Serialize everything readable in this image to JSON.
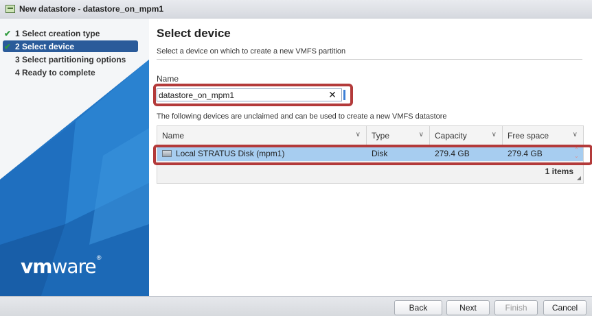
{
  "window": {
    "title": "New datastore - datastore_on_mpm1"
  },
  "wizard": {
    "steps": [
      {
        "label": "1 Select creation type",
        "checked": true
      },
      {
        "label": "2 Select device",
        "checked": true
      },
      {
        "label": "3 Select partitioning options",
        "checked": false
      },
      {
        "label": "4 Ready to complete",
        "checked": false
      }
    ],
    "active_step": 1,
    "logo": {
      "prefix": "vm",
      "suffix": "ware",
      "mark": "®"
    }
  },
  "page": {
    "heading": "Select device",
    "subtitle": "Select a device on which to create a new VMFS partition",
    "name_label": "Name",
    "name_value": "datastore_on_mpm1",
    "clear_glyph": "✕",
    "devices_description": "The following devices are unclaimed and can be used to create a new VMFS datastore"
  },
  "grid": {
    "columns": [
      "Name",
      "Type",
      "Capacity",
      "Free space"
    ],
    "rows": [
      {
        "name": "Local STRATUS Disk (mpm1)",
        "type": "Disk",
        "capacity": "279.4 GB",
        "free": "279.4 GB"
      }
    ],
    "count_label": "1 items"
  },
  "buttons": {
    "back": "Back",
    "next": "Next",
    "finish": "Finish",
    "cancel": "Cancel"
  },
  "colors": {
    "accent": "#2a5b9a",
    "selected_row": "#a7cdf0",
    "highlight": "#b33a3a",
    "check": "#2e9a3c",
    "panel_blue": "#1b66b3"
  }
}
